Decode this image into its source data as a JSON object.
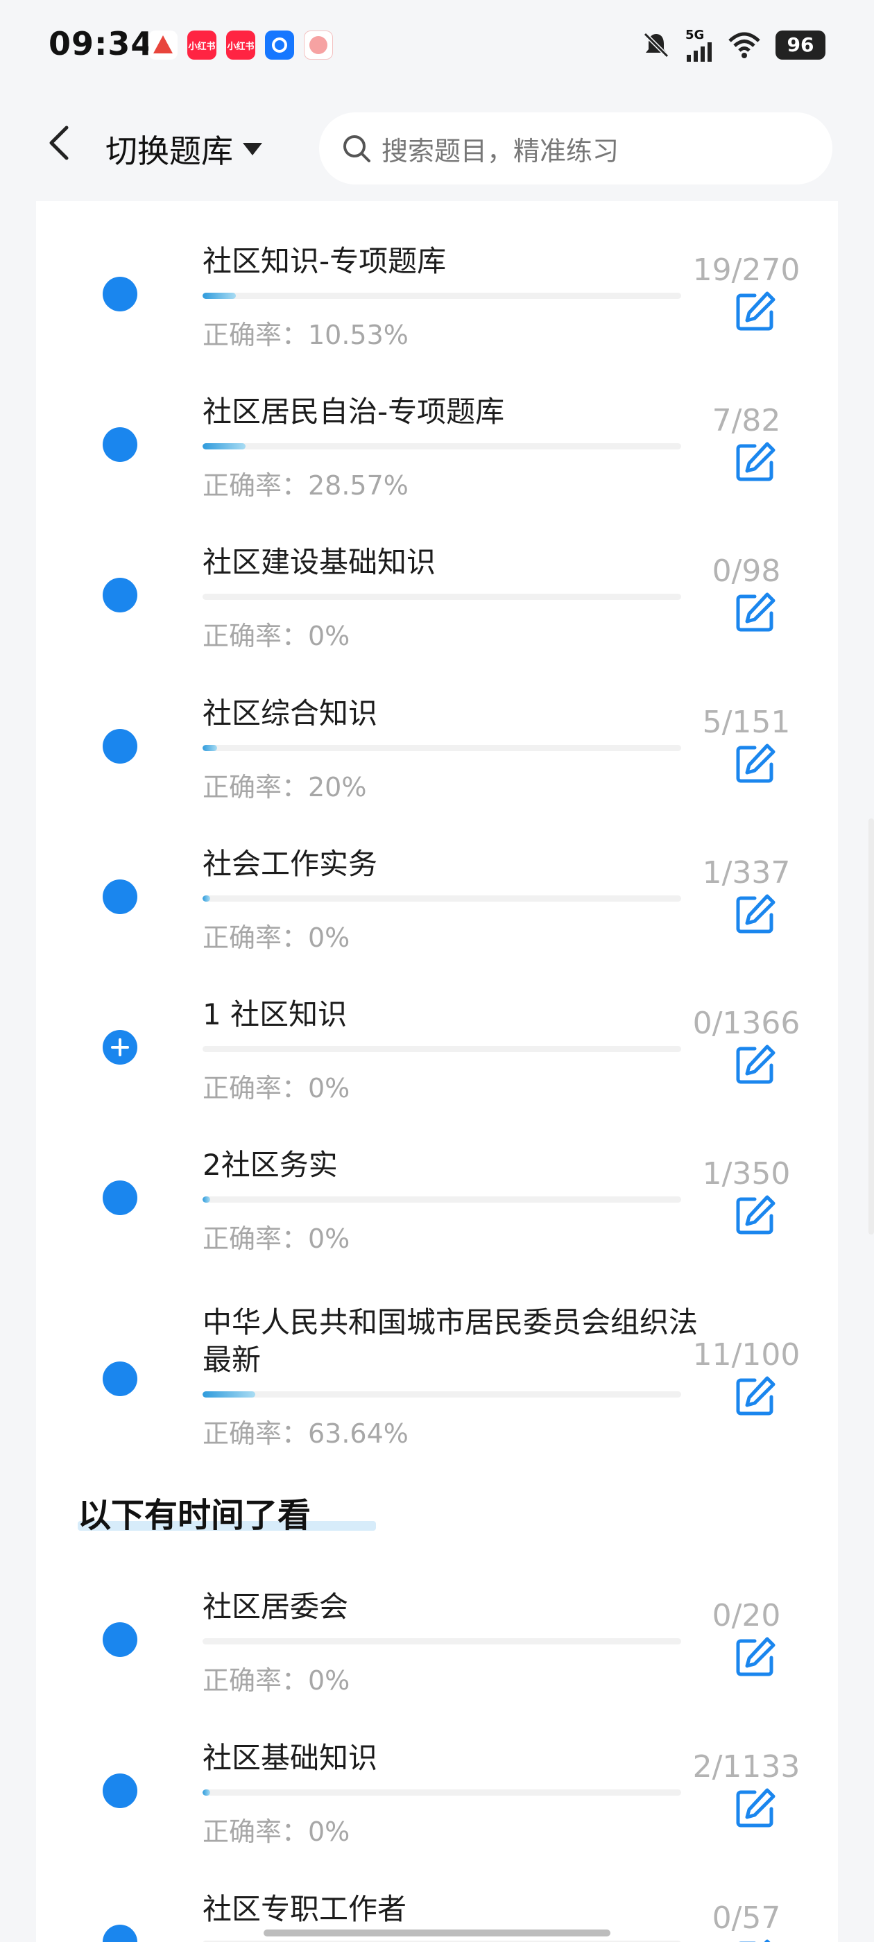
{
  "status_bar": {
    "time": "09:34",
    "network": "5G",
    "battery": "96",
    "app_icons": [
      "app-icon-1",
      "app-icon-2",
      "app-icon-3",
      "app-icon-4",
      "app-icon-5"
    ],
    "app_icon_labels": [
      "",
      "小红书",
      "小红书",
      "",
      ""
    ]
  },
  "header": {
    "title": "切换题库",
    "search_placeholder": "搜索题目，精准练习"
  },
  "items": [
    {
      "title": "社区知识-专项题库",
      "accuracy": "正确率：10.53%",
      "count": "19/270",
      "progress": 0.07,
      "icon": "dot"
    },
    {
      "title": "社区居民自治-专项题库",
      "accuracy": "正确率：28.57%",
      "count": "7/82",
      "progress": 0.09,
      "icon": "dot"
    },
    {
      "title": "社区建设基础知识",
      "accuracy": "正确率：0%",
      "count": "0/98",
      "progress": 0,
      "icon": "dot"
    },
    {
      "title": "社区综合知识",
      "accuracy": "正确率：20%",
      "count": "5/151",
      "progress": 0.03,
      "icon": "dot"
    },
    {
      "title": "社会工作实务",
      "accuracy": "正确率：0%",
      "count": "1/337",
      "progress": 0.003,
      "icon": "dot"
    },
    {
      "title": "1 社区知识",
      "accuracy": "正确率：0%",
      "count": "0/1366",
      "progress": 0,
      "icon": "plus"
    },
    {
      "title": "2社区务实",
      "accuracy": "正确率：0%",
      "count": "1/350",
      "progress": 0.003,
      "icon": "dot"
    },
    {
      "title": "中华人民共和国城市居民委员会组织法 最新",
      "accuracy": "正确率：63.64%",
      "count": "11/100",
      "progress": 0.11,
      "icon": "dot"
    }
  ],
  "section": {
    "title": "以下有时间了看"
  },
  "items2": [
    {
      "title": "社区居委会",
      "accuracy": "正确率：0%",
      "count": "0/20",
      "progress": 0,
      "icon": "dot"
    },
    {
      "title": "社区基础知识",
      "accuracy": "正确率：0%",
      "count": "2/1133",
      "progress": 0.002,
      "icon": "dot"
    },
    {
      "title": "社区专职工作者",
      "accuracy": "",
      "count": "0/57",
      "progress": 0,
      "icon": "dot"
    }
  ],
  "colors": {
    "accent": "#1a86ee",
    "progress_start": "#2f9bdc",
    "progress_end": "#a9dcf3"
  }
}
